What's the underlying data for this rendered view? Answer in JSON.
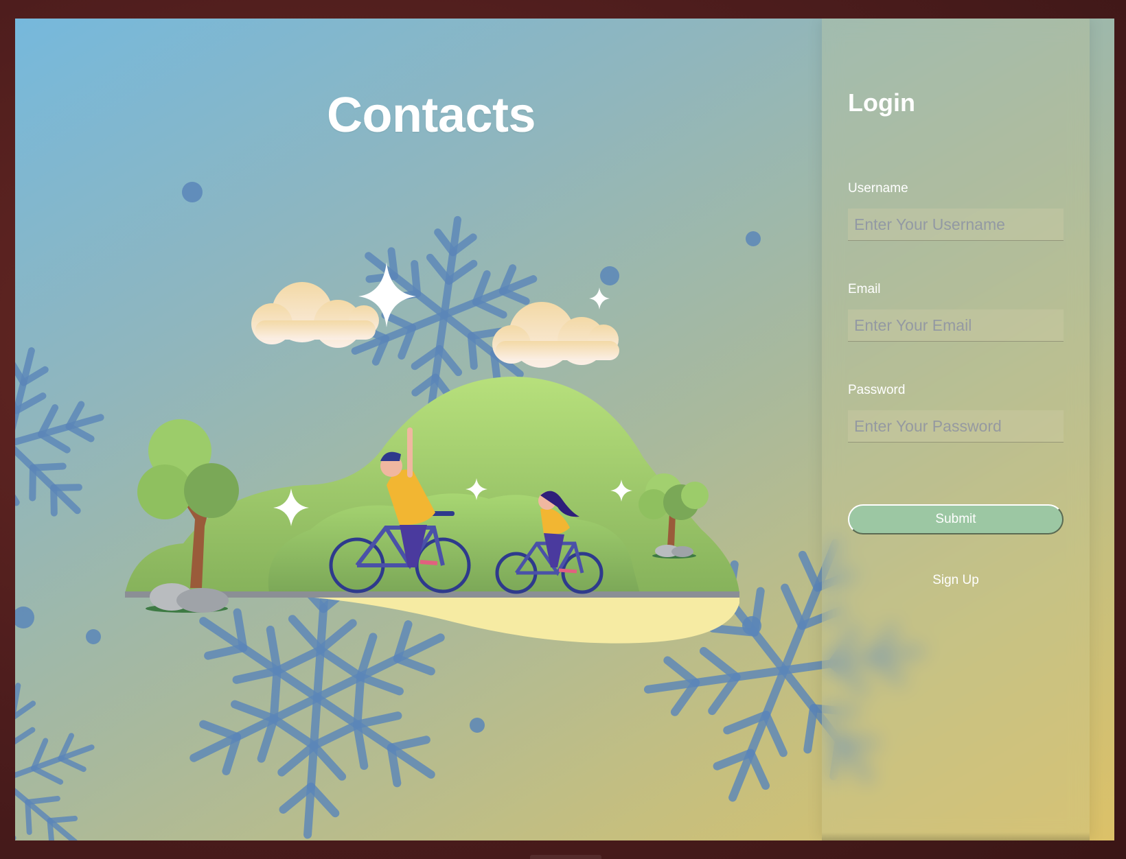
{
  "page": {
    "title": "Contacts",
    "background_gradient": [
      "#76b8dc",
      "#dcc168"
    ]
  },
  "illustration": {
    "description_icon": "family-cycling-illustration",
    "snowflake_color": "#5b86b8"
  },
  "login": {
    "title": "Login",
    "fields": [
      {
        "label": "Username",
        "placeholder": "Enter Your Username",
        "value": ""
      },
      {
        "label": "Email",
        "placeholder": "Enter Your Email",
        "value": ""
      },
      {
        "label": "Password",
        "placeholder": "Enter Your Password",
        "value": ""
      }
    ],
    "submit_label": "Submit",
    "signup_label": "Sign Up",
    "button_color": "#9cc7a3"
  }
}
